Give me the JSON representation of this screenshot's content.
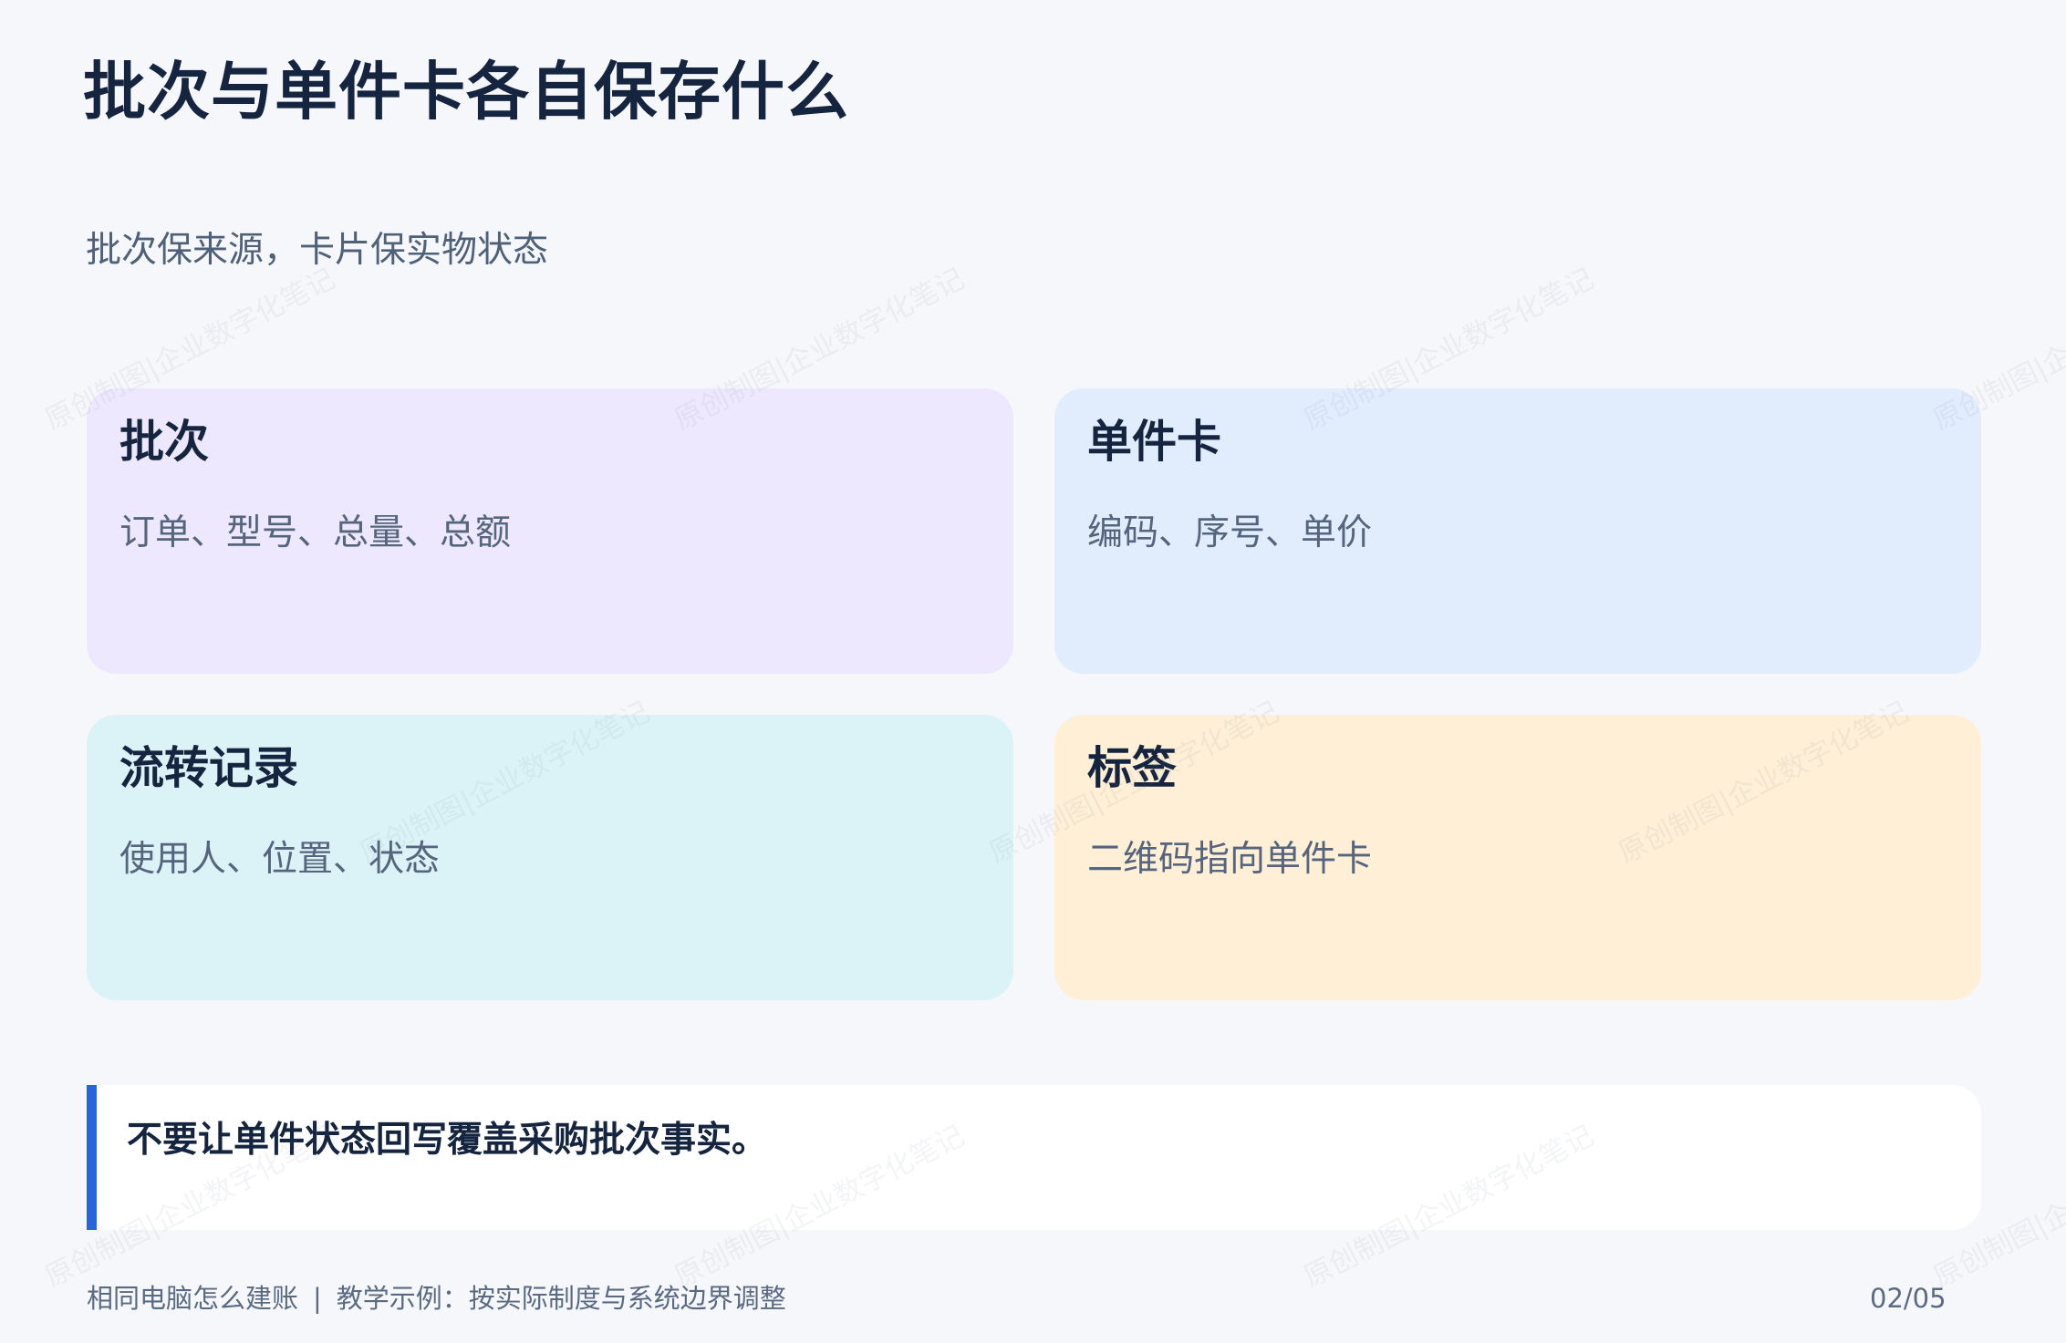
{
  "page": {
    "title": "批次与单件卡各自保存什么",
    "subtitle": "批次保来源，卡片保实物状态"
  },
  "cards": [
    {
      "title": "批次",
      "body": "订单、型号、总量、总额",
      "color": "#ede8fd"
    },
    {
      "title": "单件卡",
      "body": "编码、序号、单价",
      "color": "#e1ecfd"
    },
    {
      "title": "流转记录",
      "body": "使用人、位置、状态",
      "color": "#dbf3f7"
    },
    {
      "title": "标签",
      "body": "二维码指向单件卡",
      "color": "#feefd6"
    }
  ],
  "note": {
    "text": "不要让单件状态回写覆盖采购批次事实。",
    "accent_color": "#2864dc"
  },
  "footer": {
    "source": "相同电脑怎么建账",
    "separator": "|",
    "disclaimer": "教学示例：按实际制度与系统边界调整",
    "page_indicator": "02/05"
  },
  "watermark": {
    "text": "原创制图|企业数字化笔记"
  }
}
